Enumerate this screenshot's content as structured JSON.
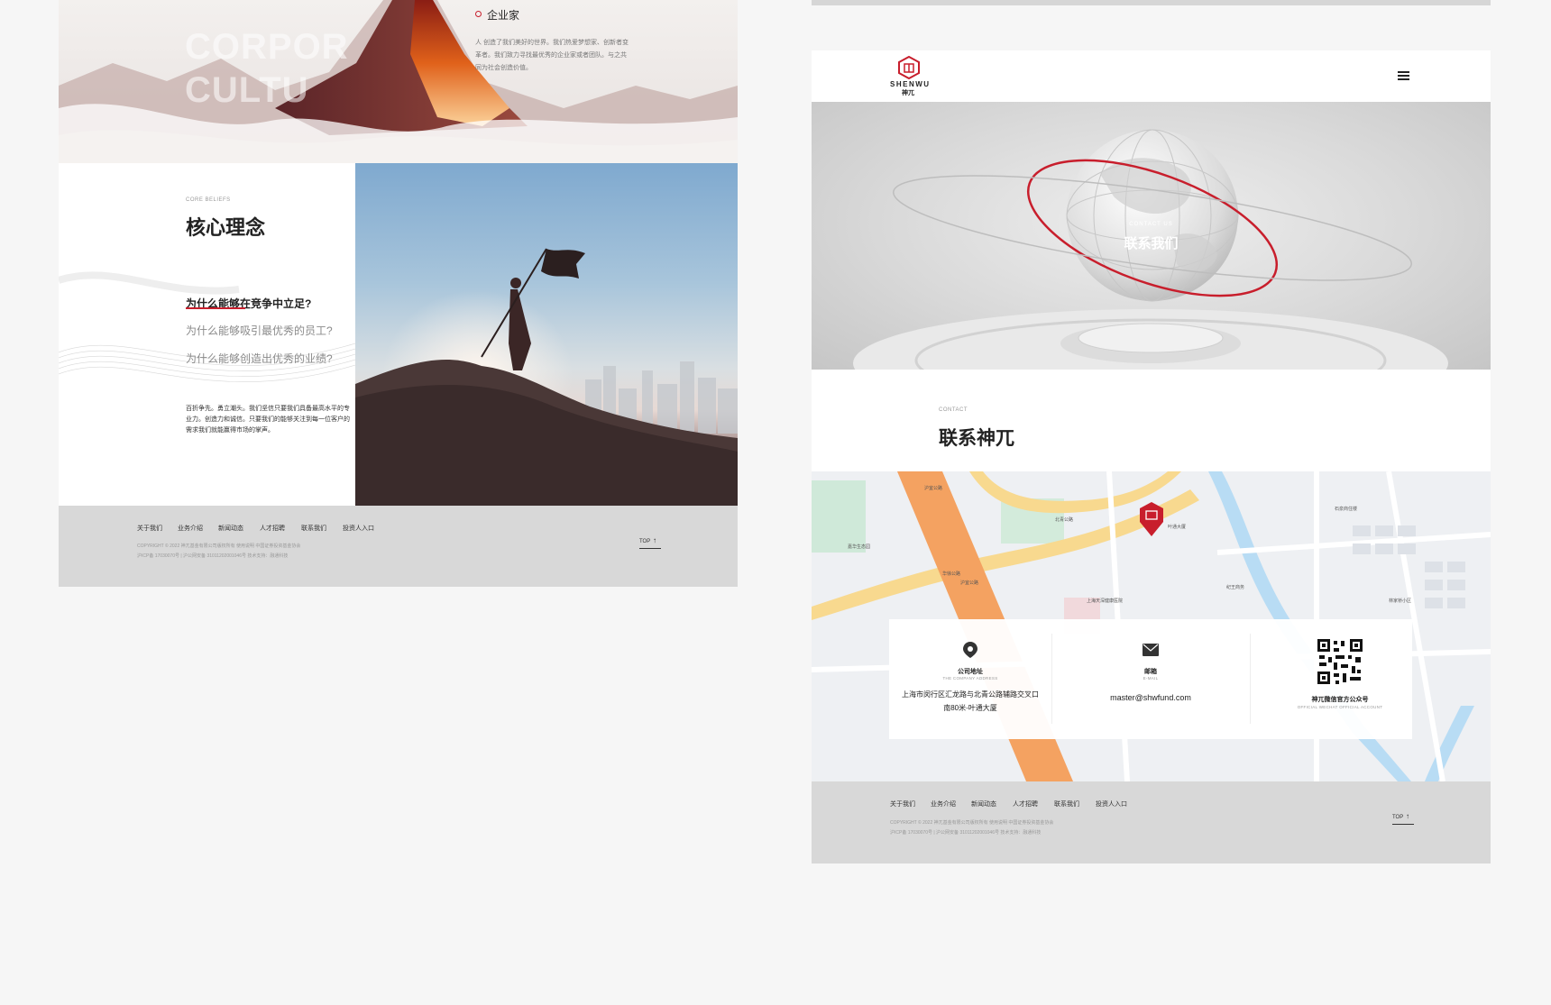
{
  "left_page": {
    "hero": {
      "ghost_line1": "CORPOR",
      "ghost_line2": "CULTU",
      "title": "企业家",
      "lines": [
        "人 创造了我们美好的世界。我们热爱梦想家、创新者变",
        "革者。我们致力寻找最优秀的企业家或者团队。与之共",
        "同为社会创造价值。"
      ]
    },
    "beliefs": {
      "label": "CORE BELIEFS",
      "heading": "核心理念",
      "questions": [
        "为什么能够在竞争中立足?",
        "为什么能够吸引最优秀的员工?",
        "为什么能够创造出优秀的业绩?"
      ],
      "body": [
        "百折争先。勇立潮头。我们坚信只要我们具备最高水平的专",
        "业力。创造力和诚信。只要我们的能够关注到每一位客户的",
        "需求我们就能赢得市场的掌声。"
      ]
    },
    "footer": {
      "nav": [
        "关于我们",
        "业务介绍",
        "新闻动态",
        "人才招聘",
        "联系我们",
        "投资人入口"
      ],
      "copy1": "COPYRIGHT © 2022 神兀基金有限公司版权所有 使用说明        中国证券投资基金协会",
      "copy2": "沪ICP备 17030070号  |  沪公网安备 31011202001046号           技术支持：融通科技",
      "top": "TOP"
    }
  },
  "right_page": {
    "logo_text": "SHENWU",
    "logo_cn": "神兀",
    "banner": {
      "small": "CONTACT US",
      "big": "联系我们"
    },
    "contact": {
      "label": "CONTACT",
      "heading": "联系神兀"
    },
    "map_labels": [
      "沪宜公路",
      "叶通大厦",
      "北青公路",
      "嘉华生态园",
      "石泉商住楼",
      "华徐公路",
      "上海天深健康医院",
      "沪宜公路",
      "纪王商务",
      "林家桥小区"
    ],
    "card": {
      "address_title": "公司地址",
      "address_sub": "THE COMPANY ADDRESS",
      "address_line1": "上海市闵行区汇龙路与北青公路辅路交叉口",
      "address_line2": "南80米-叶通大厦",
      "email_title": "邮箱",
      "email_sub": "E-MAIL",
      "email_value": "master@shwfund.com",
      "wechat_title": "神兀微信官方公众号",
      "wechat_sub": "OFFICIAL WECHAT OFFICIAL ACCOUNT"
    },
    "footer": {
      "nav": [
        "关于我们",
        "业务介绍",
        "新闻动态",
        "人才招聘",
        "联系我们",
        "投资人入口"
      ],
      "copy1": "COPYRIGHT © 2022 神兀基金有限公司版权所有 使用说明        中国证券投资基金协会",
      "copy2": "沪ICP备 17030070号  |  沪公网安备 31011202001046号           技术支持：融通科技",
      "top": "TOP"
    }
  },
  "colors": {
    "accent": "#c81e2c",
    "footer_bg": "#d8d8d8",
    "page_bg": "#f6f6f6"
  },
  "icons": [
    "menu-icon",
    "location-pin-icon",
    "mail-icon",
    "qr-code-icon",
    "up-arrow-icon"
  ]
}
